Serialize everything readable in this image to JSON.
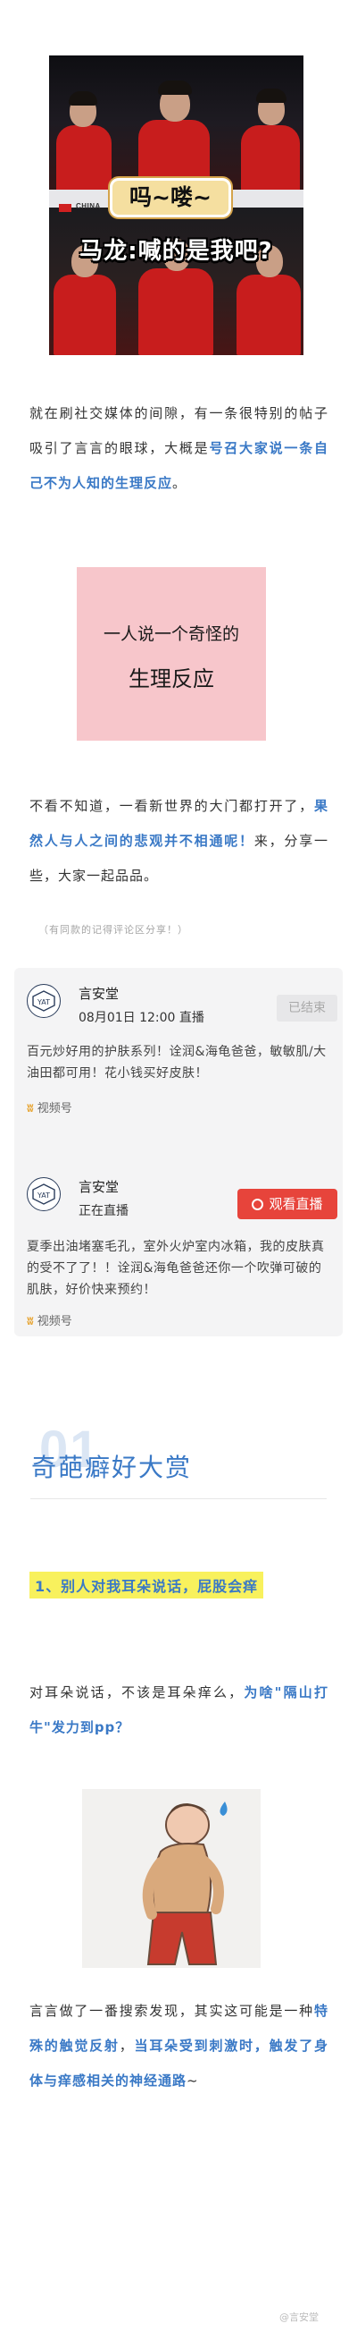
{
  "top_image": {
    "caption_1": "吗~喽~",
    "caption_2": "马龙:喊的是我吧?",
    "board_label": "CHINA"
  },
  "intro": {
    "text_a": "就在刷社交媒体的间隙，有一条很特别的帖子吸引了言言的眼球，大概是",
    "text_highlight": "号召大家说一条自己不为人知的生理反应",
    "text_b": "。"
  },
  "pink_card": {
    "line1": "一人说一个奇怪的",
    "line2": "生理反应"
  },
  "para2": {
    "text_a": "不看不知道，一看新世界的大门都打开了，",
    "text_highlight": "果然人与人之间的悲观并不相通呢！",
    "text_b": "来，分享一些，大家一起品品。"
  },
  "note": "（有同款的记得评论区分享！）",
  "live_items": [
    {
      "name": "言安堂",
      "time": "08月01日 12:00 直播",
      "button": "已结束",
      "desc": "百元炒好用的护肤系列！诠润&海龟爸爸，敏敏肌/大油田都可用！花小钱买好皮肤！",
      "channel": "视频号"
    },
    {
      "name": "言安堂",
      "time": "正在直播",
      "button": "观看直播",
      "desc": "夏季出油堵塞毛孔，室外火炉室内冰箱，我的皮肤真的受不了了！！诠润&海龟爸爸还你一个吹弹可破的肌肤，好价快来预约！",
      "channel": "视频号"
    }
  ],
  "section": {
    "number": "01",
    "title": "奇葩癖好大赏"
  },
  "item1": "1、别人对我耳朵说话，屁股会痒",
  "para3": {
    "text_a": "对耳朵说话，不该是耳朵痒么，",
    "text_highlight": "为啥\"隔山打牛\"发力到pp？"
  },
  "para4": {
    "text_a": "言言做了一番搜索发现，其实这可能是一种",
    "text_highlight_1": "特殊的触觉反射",
    "text_b": "，",
    "text_highlight_2": "当耳朵受到刺激时，触发了身体与痒感相关的神经通路",
    "text_c": "~"
  },
  "watermark": "@言安堂",
  "colors": {
    "accent_blue": "#3a79c6",
    "pink_card": "#f7c6cb",
    "live_red": "#e7443b",
    "yellow_highlight": "#f8f15d"
  }
}
